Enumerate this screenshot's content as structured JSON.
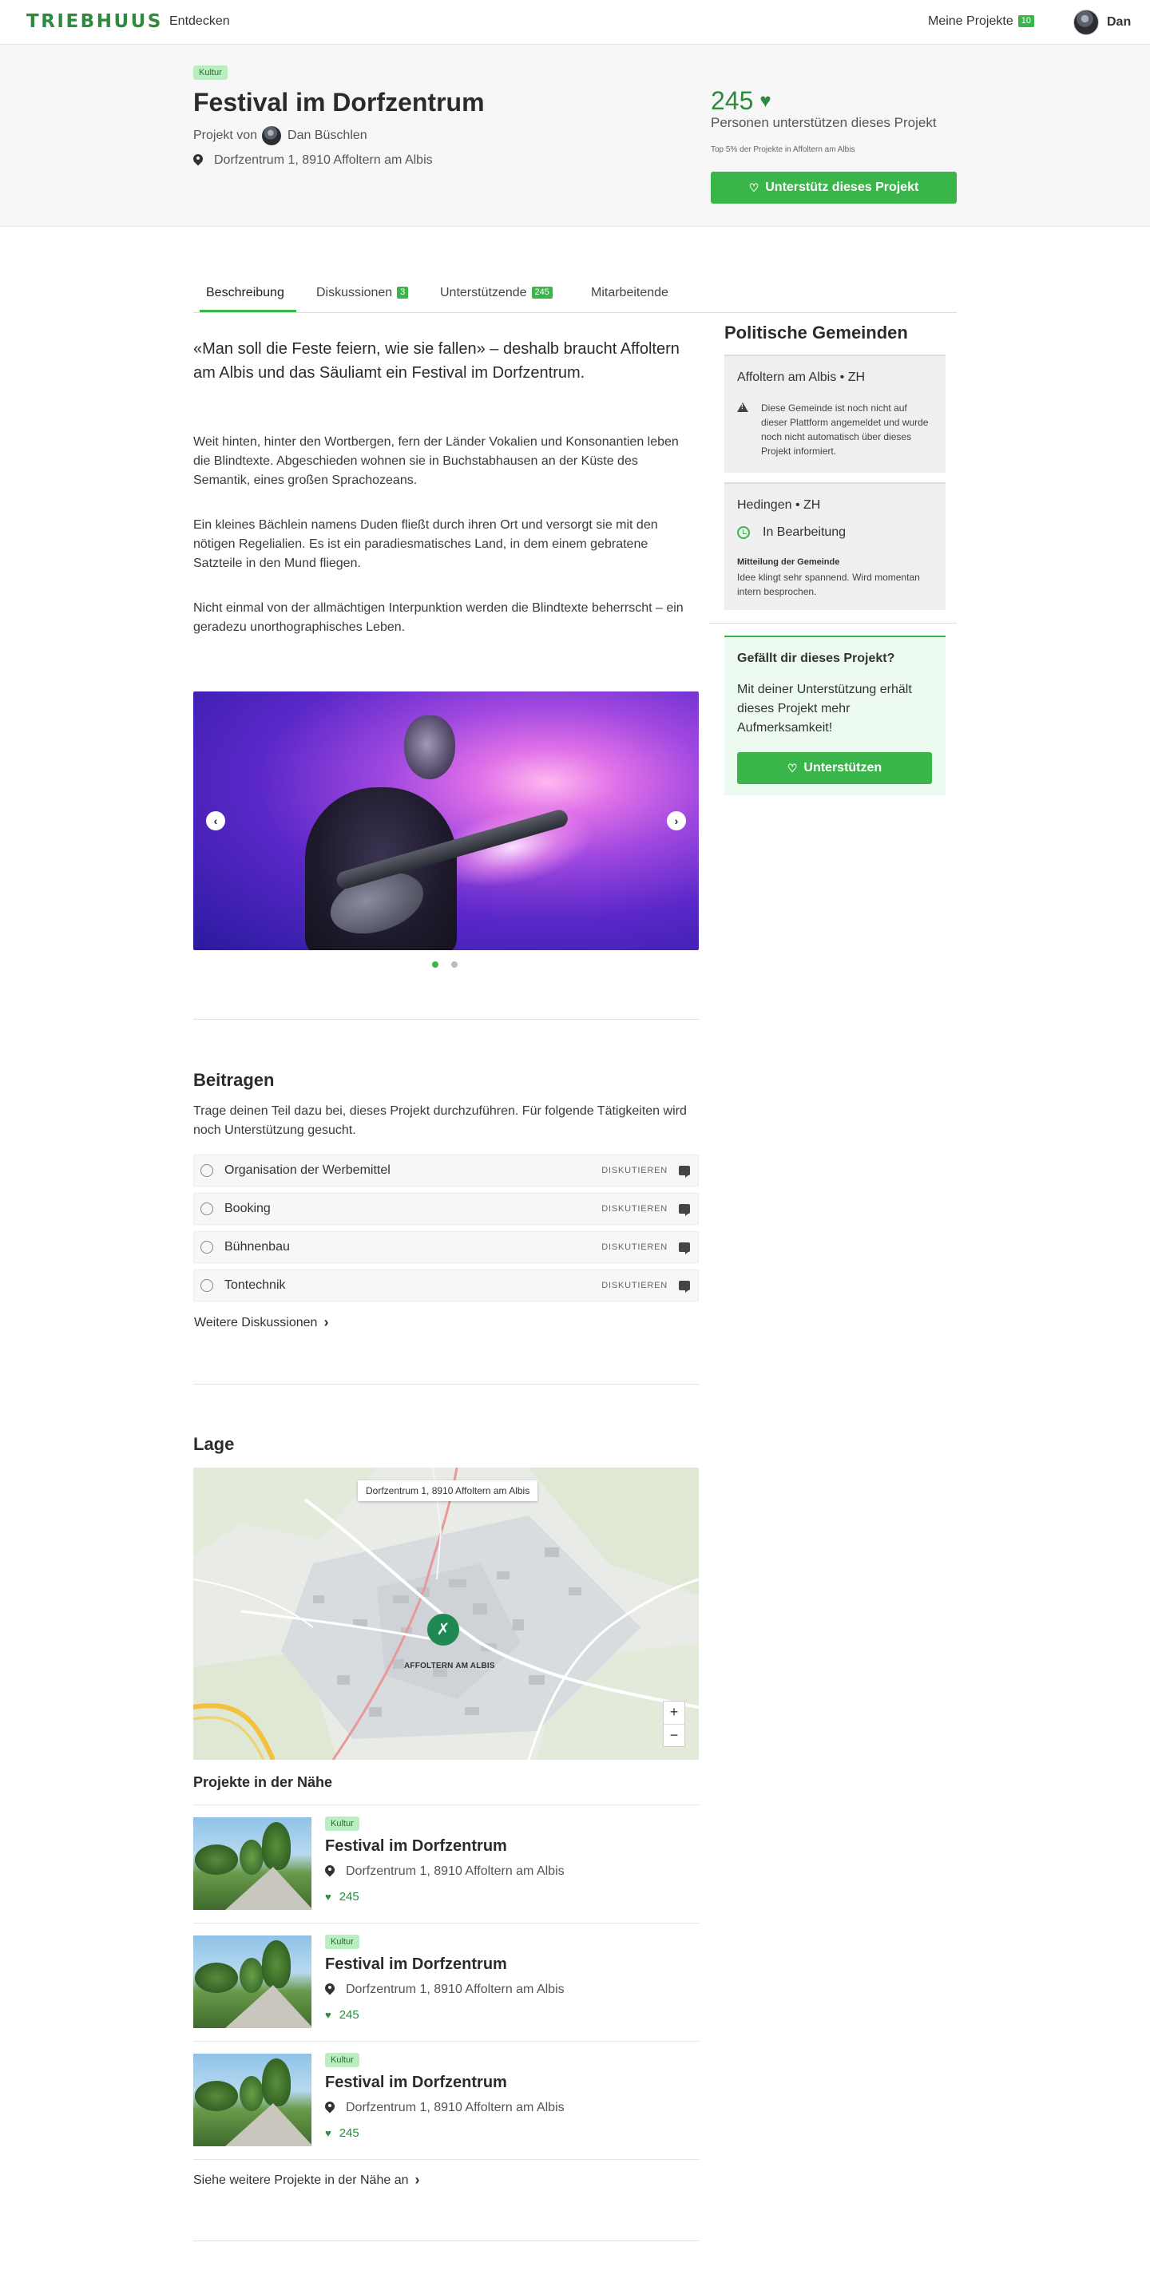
{
  "nav": {
    "logo": "TRIEBHUUS",
    "discover": "Entdecken",
    "my_projects": "Meine Projekte",
    "my_projects_count": "10",
    "user_name": "Dan"
  },
  "hero": {
    "tag": "Kultur",
    "title": "Festival im Dorfzentrum",
    "by_label": "Projekt von",
    "author": "Dan Büschlen",
    "address": "Dorfzentrum 1, 8910 Affoltern am Albis",
    "supporters_count": "245",
    "supporters_label": "Personen unterstützen dieses Projekt",
    "top_note": "Top 5% der Projekte in Affoltern am Albis",
    "support_button": "Unterstütz dieses Projekt"
  },
  "tabs": [
    {
      "label": "Beschreibung",
      "badge": ""
    },
    {
      "label": "Diskussionen",
      "badge": "3"
    },
    {
      "label": "Unterstützende",
      "badge": "245"
    },
    {
      "label": "Mitarbeitende",
      "badge": ""
    }
  ],
  "description": {
    "lead": "«Man soll die Feste feiern, wie sie fallen» – deshalb braucht Affoltern am Albis und das Säuliamt ein Festival im Dorfzentrum.",
    "paragraphs": [
      "Weit hinten, hinter den Wortbergen, fern der Länder Vokalien und Konsonantien leben die Blindtexte. Abgeschieden wohnen sie in Buchstabhausen an der Küste des Semantik, eines großen Sprachozeans.",
      "Ein kleines Bächlein namens Duden fließt durch ihren Ort und versorgt sie mit den nötigen Regelialien. Es ist ein paradiesmatisches Land, in dem einem gebratene Satzteile in den Mund fliegen.",
      "Nicht einmal von der allmächtigen Interpunktion werden die Blindtexte beherrscht – ein geradezu unorthographisches Leben."
    ]
  },
  "gallery": {
    "prev_icon": "chevron-left-icon",
    "next_icon": "chevron-right-icon",
    "slide_count": 2,
    "active_slide": 1
  },
  "contribute": {
    "title": "Beitragen",
    "intro": "Trage deinen Teil dazu bei, dieses Projekt durchzuführen. Für folgende Tätigkeiten wird noch Unterstützung gesucht.",
    "tasks": [
      {
        "label": "Organisation der Werbemittel",
        "action": "DISKUTIEREN"
      },
      {
        "label": "Booking",
        "action": "DISKUTIEREN"
      },
      {
        "label": "Bühnenbau",
        "action": "DISKUTIEREN"
      },
      {
        "label": "Tontechnik",
        "action": "DISKUTIEREN"
      }
    ],
    "more": "Weitere Diskussionen"
  },
  "location": {
    "title": "Lage",
    "tooltip": "Dorfzentrum 1, 8910 Affoltern am Albis",
    "city_label": "AFFOLTERN AM ALBIS",
    "zoom_in": "+",
    "zoom_out": "−"
  },
  "nearby": {
    "title": "Projekte in der Nähe",
    "items": [
      {
        "tag": "Kultur",
        "name": "Festival im Dorfzentrum",
        "address": "Dorfzentrum 1, 8910 Affoltern am Albis",
        "count": "245"
      },
      {
        "tag": "Kultur",
        "name": "Festival im Dorfzentrum",
        "address": "Dorfzentrum 1, 8910 Affoltern am Albis",
        "count": "245"
      },
      {
        "tag": "Kultur",
        "name": "Festival im Dorfzentrum",
        "address": "Dorfzentrum 1, 8910 Affoltern am Albis",
        "count": "245"
      }
    ],
    "more": "Siehe weitere Projekte in der Nähe an"
  },
  "sidebar": {
    "title": "Politische Gemeinden",
    "municipalities": [
      {
        "name": "Affoltern am Albis • ZH",
        "warning": "Diese Gemeinde ist noch nicht auf dieser Plattform angemeldet und wurde noch nicht automatisch über dieses Projekt informiert."
      },
      {
        "name": "Hedingen • ZH",
        "status": "In Bearbeitung",
        "message_title": "Mitteilung der Gemeinde",
        "message": "Idee klingt sehr spannend. Wird momentan intern besprochen."
      }
    ],
    "cta": {
      "title": "Gefällt dir dieses Projekt?",
      "text": "Mit deiner Unterstützung erhält dieses Projekt mehr Aufmerksamkeit!",
      "button": "Unterstützen"
    }
  },
  "colors": {
    "brand": "#2e8b3e",
    "button": "#39b54a",
    "tag_bg": "#b9efc0"
  }
}
